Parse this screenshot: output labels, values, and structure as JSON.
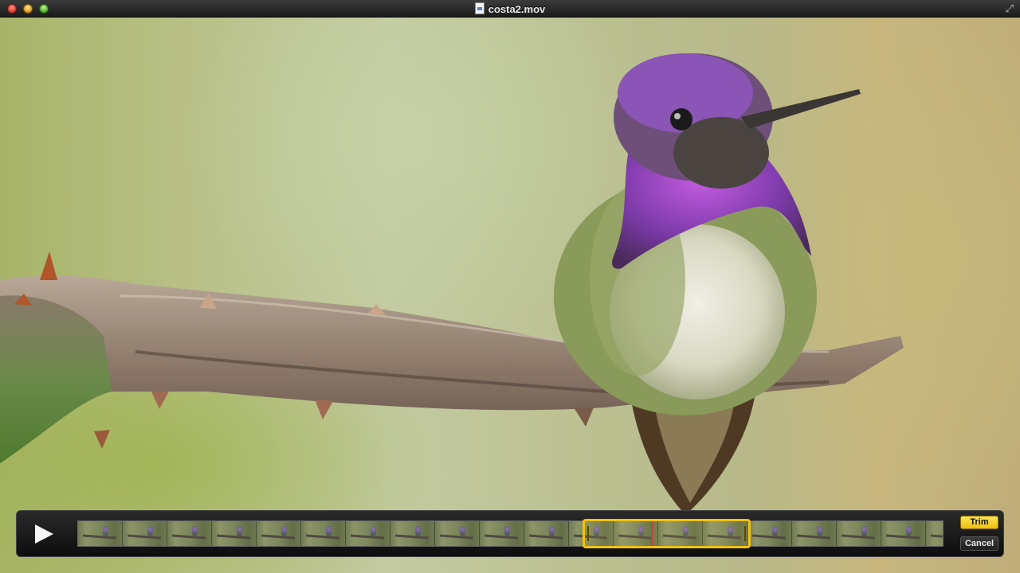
{
  "window": {
    "title": "costa2.mov"
  },
  "video": {
    "subject": "hummingbird-on-branch"
  },
  "controls": {
    "trim_label": "Trim",
    "cancel_label": "Cancel",
    "accent_color": "#f3c10f"
  },
  "icons": {
    "close": "close-button",
    "minimize": "minimize-button",
    "zoom": "zoom-button",
    "document": "document-icon",
    "fullscreen": "fullscreen-icon",
    "play": "play-icon"
  }
}
